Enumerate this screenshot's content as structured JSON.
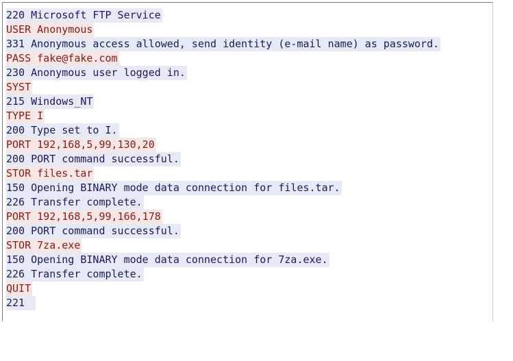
{
  "colors": {
    "client_text": "#8b1a12",
    "client_bg": "#f6e6e6",
    "server_text": "#1a1a60",
    "server_bg": "#e6e9f6"
  },
  "stream": {
    "lines": [
      {
        "dir": "server",
        "text": "220 Microsoft FTP Service"
      },
      {
        "dir": "client",
        "text": "USER Anonymous"
      },
      {
        "dir": "server",
        "text": "331 Anonymous access allowed, send identity (e-mail name) as password."
      },
      {
        "dir": "client",
        "text": "PASS fake@fake.com"
      },
      {
        "dir": "server",
        "text": "230 Anonymous user logged in."
      },
      {
        "dir": "client",
        "text": "SYST"
      },
      {
        "dir": "server",
        "text": "215 Windows_NT"
      },
      {
        "dir": "client",
        "text": "TYPE I"
      },
      {
        "dir": "server",
        "text": "200 Type set to I."
      },
      {
        "dir": "client",
        "text": "PORT 192,168,5,99,130,20"
      },
      {
        "dir": "server",
        "text": "200 PORT command successful."
      },
      {
        "dir": "client",
        "text": "STOR files.tar"
      },
      {
        "dir": "server",
        "text": "150 Opening BINARY mode data connection for files.tar."
      },
      {
        "dir": "server",
        "text": "226 Transfer complete."
      },
      {
        "dir": "client",
        "text": "PORT 192,168,5,99,166,178"
      },
      {
        "dir": "server",
        "text": "200 PORT command successful."
      },
      {
        "dir": "client",
        "text": "STOR 7za.exe"
      },
      {
        "dir": "server",
        "text": "150 Opening BINARY mode data connection for 7za.exe."
      },
      {
        "dir": "server",
        "text": "226 Transfer complete."
      },
      {
        "dir": "client",
        "text": "QUIT"
      },
      {
        "dir": "server",
        "text": "221"
      }
    ]
  }
}
